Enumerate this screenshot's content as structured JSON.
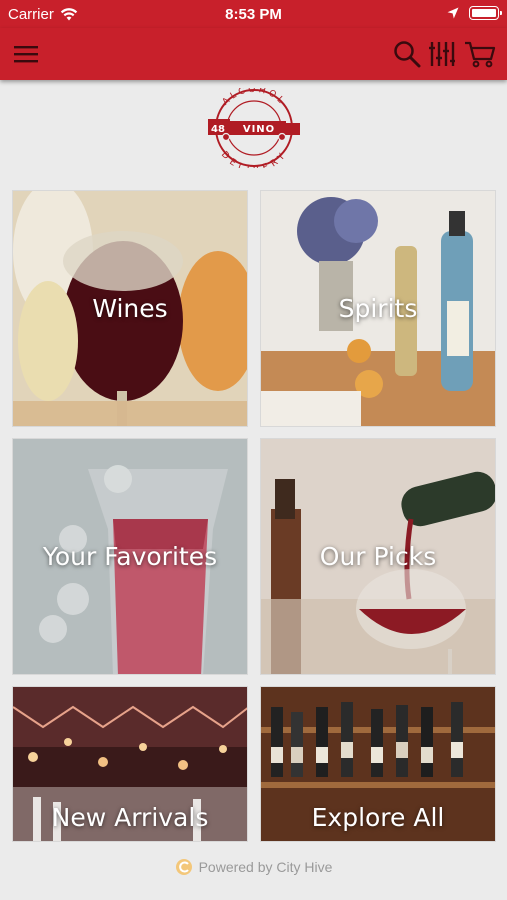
{
  "status_bar": {
    "carrier": "Carrier",
    "time": "8:53 PM"
  },
  "nav_bar": {
    "menu_icon": "hamburger-icon",
    "search_icon": "search-icon",
    "filter_icon": "filter-icon",
    "cart_icon": "cart-icon",
    "color": "#c8202b"
  },
  "logo": {
    "text_top": "ALCOHOL",
    "text_bottom": "DELIVERY",
    "number": "48",
    "brand": "VINO"
  },
  "tiles": [
    {
      "label": "Wines"
    },
    {
      "label": "Spirits"
    },
    {
      "label": "Your Favorites"
    },
    {
      "label": "Our Picks"
    },
    {
      "label": "New Arrivals"
    },
    {
      "label": "Explore All"
    }
  ],
  "footer": {
    "text": "Powered by City Hive",
    "icon": "city-hive-icon"
  }
}
